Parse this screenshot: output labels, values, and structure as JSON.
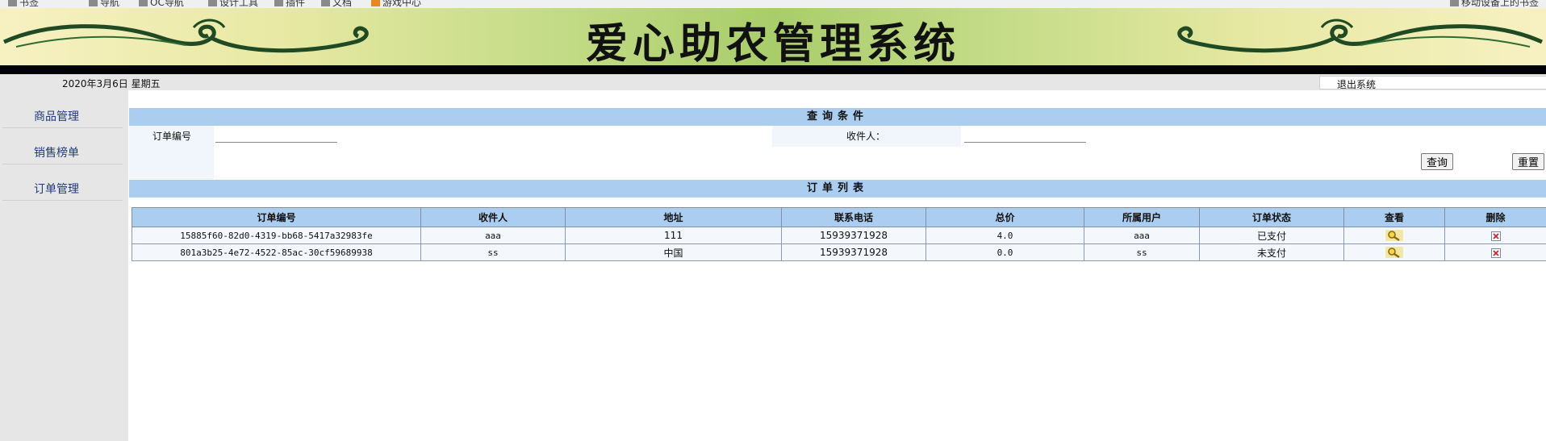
{
  "bookmarks": [
    {
      "label": "书签",
      "icon": "folder-icon"
    },
    {
      "label": "导航",
      "icon": "folder-icon"
    },
    {
      "label": "OC导航",
      "icon": "folder-icon"
    },
    {
      "label": "设计工具",
      "icon": "folder-icon"
    },
    {
      "label": "插件",
      "icon": "folder-icon"
    },
    {
      "label": "文档",
      "icon": "folder-icon"
    },
    {
      "label": "游戏中心",
      "icon": "rss-icon"
    },
    {
      "label": "移动设备上的书签",
      "icon": "folder-icon"
    }
  ],
  "banner": {
    "title": "爱心助农管理系统"
  },
  "header": {
    "date": "2020年3月6日  星期五",
    "logout_label": "退出系统"
  },
  "sidebar": {
    "items": [
      {
        "label": "商品管理"
      },
      {
        "label": "销售榜单"
      },
      {
        "label": "订单管理"
      }
    ]
  },
  "query": {
    "section_title": "查询条件",
    "order_no_label": "订单编号",
    "order_no_value": "",
    "receiver_label": "收件人：",
    "receiver_value": "",
    "search_button": "查询",
    "reset_button": "重置"
  },
  "list": {
    "section_title": "订单列表",
    "columns": [
      "订单编号",
      "收件人",
      "地址",
      "联系电话",
      "总价",
      "所属用户",
      "订单状态",
      "查看",
      "删除"
    ],
    "rows": [
      {
        "order_no": "15885f60-82d0-4319-bb68-5417a32983fe",
        "receiver": "aaa",
        "address": "111",
        "phone": "15939371928",
        "total": "4.0",
        "user": "aaa",
        "status": "已支付"
      },
      {
        "order_no": "801a3b25-4e72-4522-85ac-30cf59689938",
        "receiver": "ss",
        "address": "中国",
        "phone": "15939371928",
        "total": "0.0",
        "user": "ss",
        "status": "未支付"
      }
    ]
  },
  "colors": {
    "header_blue": "#aacdf0",
    "row_bg": "#f4f8fd",
    "sidebar_bg": "#e6e6e6",
    "sidebar_link": "#223b78"
  }
}
